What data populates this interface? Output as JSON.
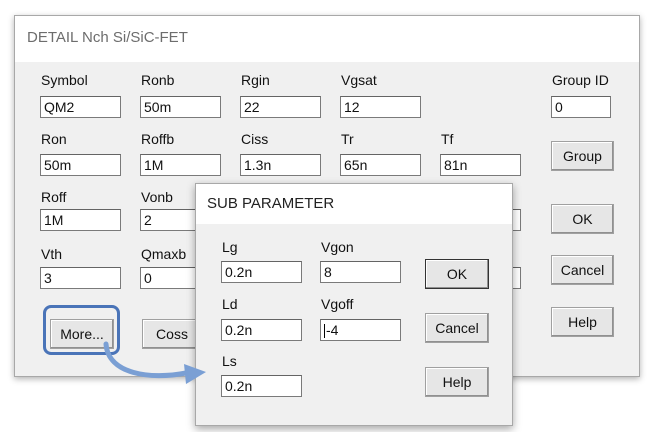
{
  "main_dialog": {
    "title": "DETAIL Nch Si/SiC-FET",
    "fields": {
      "symbol": {
        "label": "Symbol",
        "value": "QM2"
      },
      "ronb": {
        "label": "Ronb",
        "value": "50m"
      },
      "rgin": {
        "label": "Rgin",
        "value": "22"
      },
      "vgsat": {
        "label": "Vgsat",
        "value": "12"
      },
      "group_id": {
        "label": "Group ID",
        "value": "0"
      },
      "ron": {
        "label": "Ron",
        "value": "50m"
      },
      "roffb": {
        "label": "Roffb",
        "value": "1M"
      },
      "ciss": {
        "label": "Ciss",
        "value": "1.3n"
      },
      "tr": {
        "label": "Tr",
        "value": "65n"
      },
      "tf": {
        "label": "Tf",
        "value": "81n"
      },
      "roff": {
        "label": "Roff",
        "value": "1M"
      },
      "vonb": {
        "label": "Vonb",
        "value": "2"
      },
      "vth": {
        "label": "Vth",
        "value": "3"
      },
      "qmaxb": {
        "label": "Qmaxb",
        "value": "0"
      }
    },
    "buttons": {
      "group": "Group",
      "ok": "OK",
      "cancel": "Cancel",
      "help": "Help",
      "more": "More...",
      "coss": "Coss"
    }
  },
  "sub_dialog": {
    "title": "SUB PARAMETER",
    "fields": {
      "lg": {
        "label": "Lg",
        "value": "0.2n"
      },
      "vgon": {
        "label": "Vgon",
        "value": "8"
      },
      "ld": {
        "label": "Ld",
        "value": "0.2n"
      },
      "vgoff": {
        "label": "Vgoff",
        "value": "-4"
      },
      "ls": {
        "label": "Ls",
        "value": "0.2n"
      }
    },
    "buttons": {
      "ok": "OK",
      "cancel": "Cancel",
      "help": "Help"
    }
  },
  "colors": {
    "dialog_bg": "#f0f0f0",
    "highlight_border": "#4a74b8",
    "arrow": "#7a9fd4"
  },
  "icons": [
    "curved-arrow-icon",
    "text-cursor-icon"
  ]
}
